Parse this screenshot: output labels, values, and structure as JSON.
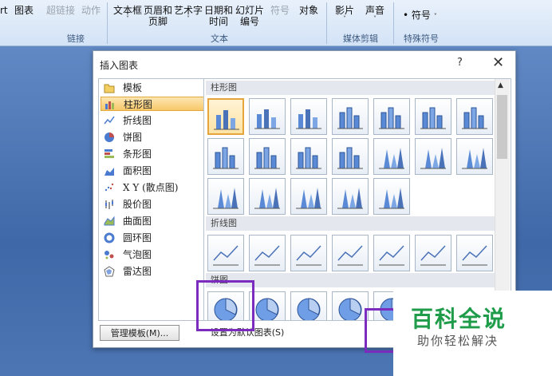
{
  "ribbon": {
    "items": [
      {
        "id": "chart-partial",
        "label": "rt",
        "sub": "",
        "disabled": false
      },
      {
        "id": "chart",
        "label": "图表",
        "sub": "",
        "disabled": false
      },
      {
        "id": "hyperlink",
        "label": "超链接",
        "sub": "",
        "disabled": true
      },
      {
        "id": "action",
        "label": "动作",
        "sub": "",
        "disabled": true
      },
      {
        "id": "textbox",
        "label": "文本框",
        "sub": "",
        "arrow": "˅"
      },
      {
        "id": "header-footer",
        "label": "页眉和",
        "sub": "页脚"
      },
      {
        "id": "wordart",
        "label": "艺术字",
        "sub": "",
        "arrow": "˅"
      },
      {
        "id": "datetime",
        "label": "日期和",
        "sub": "时间"
      },
      {
        "id": "slide-number",
        "label": "幻灯片",
        "sub": "编号"
      },
      {
        "id": "symbol",
        "label": "符号",
        "sub": "",
        "disabled": true
      },
      {
        "id": "object",
        "label": "对象",
        "sub": ""
      },
      {
        "id": "movie",
        "label": "影片",
        "sub": "",
        "arrow": "˅"
      },
      {
        "id": "sound",
        "label": "声音",
        "sub": "",
        "arrow": "˅"
      },
      {
        "id": "special-symbol",
        "label": "符号",
        "sub": "",
        "arrow": "˅"
      }
    ],
    "groups": {
      "links": "链接",
      "text": "文本",
      "media": "媒体剪辑",
      "special": "特殊符号"
    }
  },
  "dialog": {
    "title": "插入图表",
    "help": "?",
    "close": "✕",
    "categories": [
      {
        "label": "模板",
        "icon": "folder-icon"
      },
      {
        "label": "柱形图",
        "icon": "column-chart-icon",
        "selected": true
      },
      {
        "label": "折线图",
        "icon": "line-chart-icon"
      },
      {
        "label": "饼图",
        "icon": "pie-chart-icon"
      },
      {
        "label": "条形图",
        "icon": "bar-chart-icon"
      },
      {
        "label": "面积图",
        "icon": "area-chart-icon"
      },
      {
        "label": "X Y (散点图)",
        "icon": "scatter-chart-icon"
      },
      {
        "label": "股价图",
        "icon": "stock-chart-icon"
      },
      {
        "label": "曲面图",
        "icon": "surface-chart-icon"
      },
      {
        "label": "圆环图",
        "icon": "doughnut-chart-icon"
      },
      {
        "label": "气泡图",
        "icon": "bubble-chart-icon"
      },
      {
        "label": "雷达图",
        "icon": "radar-chart-icon"
      }
    ],
    "sections": {
      "column": "柱形图",
      "line": "折线图",
      "pie": "饼图"
    },
    "buttons": {
      "manage": "管理模板(M)...",
      "set_default": "设置为默认图表(S)"
    }
  },
  "watermark": {
    "title": "百科全说",
    "subtitle": "助你轻松解决"
  },
  "colors": {
    "highlight": "#7b2cbf",
    "selection": "#f7c86a",
    "accent": "#1f9c4a"
  }
}
